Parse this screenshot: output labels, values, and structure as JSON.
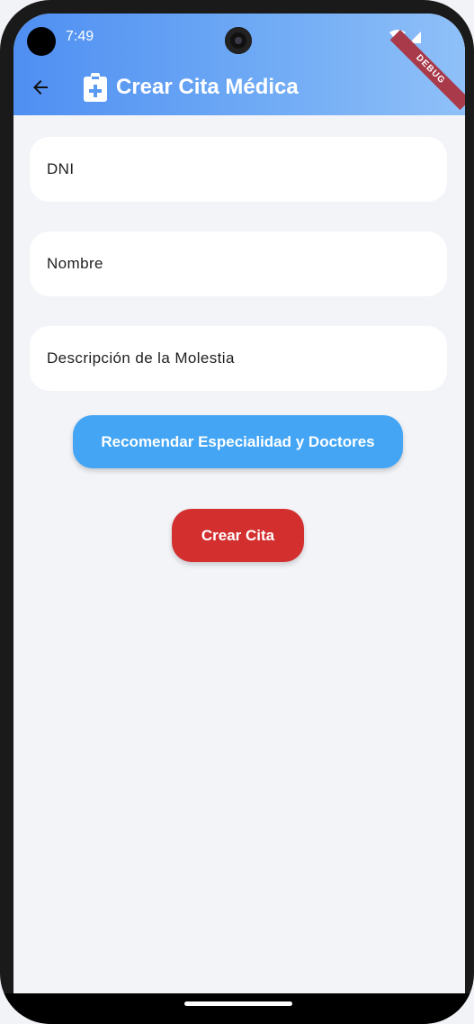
{
  "status_bar": {
    "time": "7:49",
    "icons": [
      "wifi-icon",
      "signal-icon"
    ],
    "debug_label": "DEBUG"
  },
  "appbar": {
    "title": "Crear Cita Médica",
    "back_icon": "arrow-back-icon",
    "title_icon": "clipboard-plus-icon",
    "gradient_start": "#4f8ff2",
    "gradient_end": "#8fc0f8"
  },
  "form": {
    "dni_placeholder": "DNI",
    "nombre_placeholder": "Nombre",
    "descripcion_placeholder": "Descripción de la Molestia"
  },
  "buttons": {
    "recommend_label": "Recomendar Especialidad y Doctores",
    "recommend_color": "#44a5f4",
    "create_label": "Crear Cita",
    "create_color": "#d32f2f"
  }
}
